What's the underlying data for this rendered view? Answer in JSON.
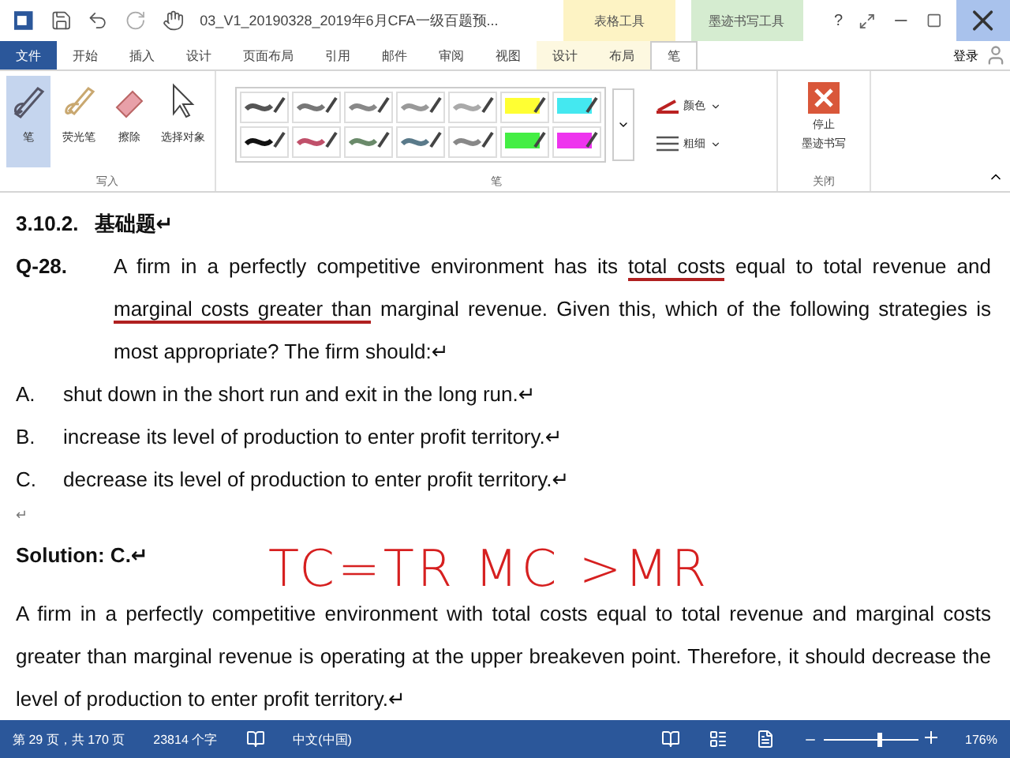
{
  "title_bar": {
    "title": "03_V1_20190328_2019年6月CFA一级百题预...",
    "context_groups": [
      {
        "label": "表格工具",
        "color": "#fdf3c4"
      },
      {
        "label": "墨迹书写工具",
        "color": "#d5ecd0"
      }
    ],
    "help": "?"
  },
  "tabs": [
    {
      "label": "文件",
      "kind": "file",
      "selected": false
    },
    {
      "label": "开始",
      "kind": "tab",
      "selected": false
    },
    {
      "label": "插入",
      "kind": "tab",
      "selected": false
    },
    {
      "label": "设计",
      "kind": "tab",
      "selected": false
    },
    {
      "label": "页面布局",
      "kind": "tab",
      "selected": false
    },
    {
      "label": "引用",
      "kind": "tab",
      "selected": false
    },
    {
      "label": "邮件",
      "kind": "tab",
      "selected": false
    },
    {
      "label": "审阅",
      "kind": "tab",
      "selected": false
    },
    {
      "label": "视图",
      "kind": "tab",
      "selected": false
    },
    {
      "label": "设计",
      "kind": "table",
      "selected": false
    },
    {
      "label": "布局",
      "kind": "table",
      "selected": false
    },
    {
      "label": "笔",
      "kind": "ink",
      "selected": true
    }
  ],
  "sign_in": "登录",
  "ribbon": {
    "write_tools": [
      {
        "label": "笔",
        "kind": "pen",
        "selected": true
      },
      {
        "label": "荧光笔",
        "kind": "highlighter",
        "selected": false
      },
      {
        "label": "擦除",
        "kind": "eraser",
        "selected": false
      },
      {
        "label": "选择对象",
        "kind": "select",
        "selected": false
      }
    ],
    "write_group": "写入",
    "pens": [
      {
        "color": "#555555",
        "kind": "line"
      },
      {
        "color": "#777777",
        "kind": "line"
      },
      {
        "color": "#888888",
        "kind": "line"
      },
      {
        "color": "#999999",
        "kind": "line"
      },
      {
        "color": "#aaaaaa",
        "kind": "line"
      },
      {
        "color": "#ffff33",
        "kind": "marker"
      },
      {
        "color": "#44e8f0",
        "kind": "marker"
      },
      {
        "color": "#111111",
        "kind": "line"
      },
      {
        "color": "#c0506a",
        "kind": "line"
      },
      {
        "color": "#6a8a6a",
        "kind": "line"
      },
      {
        "color": "#5a7a8a",
        "kind": "line"
      },
      {
        "color": "#888888",
        "kind": "line"
      },
      {
        "color": "#44ee44",
        "kind": "marker"
      },
      {
        "color": "#ee33ee",
        "kind": "marker"
      }
    ],
    "color_label": "颜色",
    "weight_label": "粗细",
    "pen_group": "笔",
    "stop_label": [
      "停止",
      "墨迹书写"
    ],
    "close_group": "关闭"
  },
  "document": {
    "heading_number": "3.10.2.",
    "heading_text": "基础题↵",
    "question_number": "Q-28.",
    "question": [
      {
        "text": "A firm in a perfectly competitive environment has its ",
        "underlined": false
      },
      {
        "text": "total costs",
        "underlined": true
      },
      {
        "text": " equal to total revenue and ",
        "underlined": false
      },
      {
        "text": "marginal costs greater than",
        "underlined": true
      },
      {
        "text": " marginal revenue. Given this, which of the following strategies is most appropriate? The firm should:↵",
        "underlined": false
      }
    ],
    "options": [
      {
        "letter": "A.",
        "text": "shut down in the short run and exit in the long run.↵"
      },
      {
        "letter": "B.",
        "text": "increase its level of production to enter profit territory.↵"
      },
      {
        "letter": "C.",
        "text": "decrease its level of production to enter profit territory.↵"
      }
    ],
    "empty_mark": "↵",
    "handwriting": "TC=TR  MC >MR",
    "solution_label": "Solution: C.↵",
    "solution": "A firm in a perfectly competitive environment with total costs equal to total revenue and marginal costs greater than marginal revenue is operating at the upper breakeven point. Therefore, it should decrease the level of production to enter profit territory.↵"
  },
  "status_bar": {
    "page": "第 29 页，共 170 页",
    "words": "23814 个字",
    "language": "中文(中国)",
    "zoom": "176%",
    "zoom_slider": {
      "level": 0.58
    }
  }
}
